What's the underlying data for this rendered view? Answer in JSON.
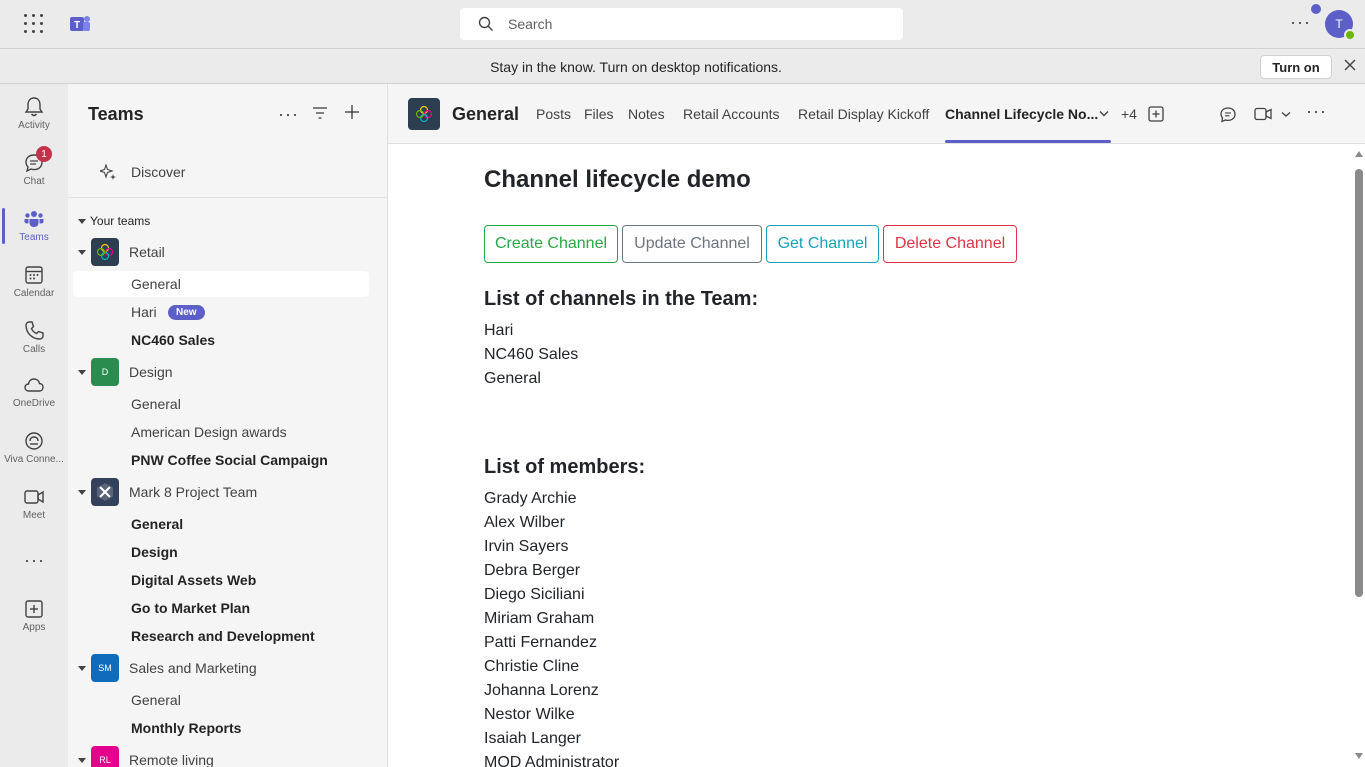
{
  "topbar": {
    "search_placeholder": "Search",
    "more": "···",
    "avatar_initial": "T"
  },
  "banner": {
    "text": "Stay in the know. Turn on desktop notifications.",
    "turn_on": "Turn on"
  },
  "rail": {
    "items": [
      {
        "label": "Activity",
        "icon": "bell-icon"
      },
      {
        "label": "Chat",
        "icon": "chat-icon",
        "badge": "1"
      },
      {
        "label": "Teams",
        "icon": "teams-icon"
      },
      {
        "label": "Calendar",
        "icon": "calendar-icon"
      },
      {
        "label": "Calls",
        "icon": "phone-icon"
      },
      {
        "label": "OneDrive",
        "icon": "cloud-icon"
      },
      {
        "label": "Viva Conne...",
        "icon": "viva-icon"
      },
      {
        "label": "Meet",
        "icon": "video-icon"
      },
      {
        "label": "Apps",
        "icon": "apps-icon"
      }
    ],
    "more": "···"
  },
  "panel": {
    "title": "Teams",
    "discover": "Discover",
    "your_teams": "Your teams",
    "teams": [
      {
        "name": "Retail",
        "initials": "",
        "color": "#2d3e50",
        "channels": [
          {
            "label": "General",
            "bold": false,
            "selected": true
          },
          {
            "label": "Hari",
            "bold": false,
            "badge": "New"
          },
          {
            "label": "NC460 Sales",
            "bold": true
          }
        ]
      },
      {
        "name": "Design",
        "initials": "D",
        "color": "#2a8d4f",
        "channels": [
          {
            "label": "General",
            "bold": false
          },
          {
            "label": "American Design awards",
            "bold": false
          },
          {
            "label": "PNW Coffee Social Campaign",
            "bold": true
          }
        ]
      },
      {
        "name": "Mark 8 Project Team",
        "initials": "",
        "color": "#34415a",
        "channels": [
          {
            "label": "General",
            "bold": true
          },
          {
            "label": "Design",
            "bold": true
          },
          {
            "label": "Digital Assets Web",
            "bold": true
          },
          {
            "label": "Go to Market Plan",
            "bold": true
          },
          {
            "label": "Research and Development",
            "bold": true
          }
        ]
      },
      {
        "name": "Sales and Marketing",
        "initials": "SM",
        "color": "#0f6cbd",
        "channels": [
          {
            "label": "General",
            "bold": false
          },
          {
            "label": "Monthly Reports",
            "bold": true
          }
        ]
      },
      {
        "name": "Remote living",
        "initials": "RL",
        "color": "#e3008c",
        "channels": []
      }
    ]
  },
  "header": {
    "channel_name": "General",
    "tabs": [
      "Posts",
      "Files",
      "Notes",
      "Retail Accounts",
      "Retail Display Kickoff",
      "Channel Lifecycle No..."
    ],
    "more_tabs": "+4"
  },
  "content": {
    "title": "Channel lifecycle demo",
    "buttons": {
      "create": "Create Channel",
      "update": "Update Channel",
      "get": "Get Channel",
      "delete": "Delete Channel"
    },
    "channels_heading": "List of channels in the Team:",
    "channels": [
      "Hari",
      "NC460 Sales",
      "General"
    ],
    "members_heading": "List of members:",
    "members": [
      "Grady Archie",
      "Alex Wilber",
      "Irvin Sayers",
      "Debra Berger",
      "Diego Siciliani",
      "Miriam Graham",
      "Patti Fernandez",
      "Christie Cline",
      "Johanna Lorenz",
      "Nestor Wilke",
      "Isaiah Langer",
      "MOD Administrator"
    ]
  }
}
